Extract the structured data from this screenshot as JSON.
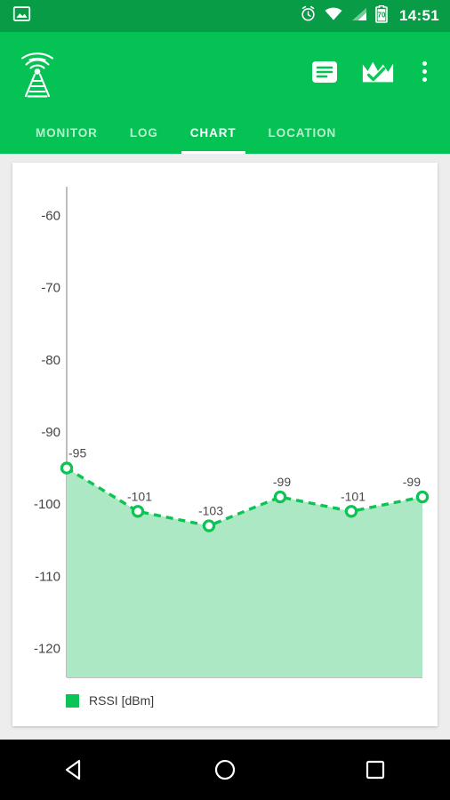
{
  "statusbar": {
    "time": "14:51",
    "battery_level": "70",
    "icons": [
      "image-icon",
      "alarm-icon",
      "wifi-icon",
      "signal-icon",
      "battery-icon"
    ]
  },
  "appbar": {
    "logo_icon": "cell-tower-icon",
    "actions": [
      {
        "name": "log-list-icon",
        "label": "Log"
      },
      {
        "name": "chart-check-icon",
        "label": "Chart"
      },
      {
        "name": "overflow-menu-icon",
        "label": "More options"
      }
    ]
  },
  "tabs": [
    {
      "label": "MONITOR",
      "active": false
    },
    {
      "label": "LOG",
      "active": false
    },
    {
      "label": "CHART",
      "active": true
    },
    {
      "label": "LOCATION",
      "active": false
    }
  ],
  "legend": {
    "label": "RSSI [dBm]",
    "color": "#0BC453"
  },
  "colors": {
    "statusbar": "#079C45",
    "appbar": "#05C254",
    "accent": "#0BC453",
    "area_fill": "#ACE8C4",
    "background": "#EDEDED",
    "card": "#FFFFFF"
  },
  "navbar": {
    "buttons": [
      {
        "name": "back-button",
        "label": "Back"
      },
      {
        "name": "home-button",
        "label": "Home"
      },
      {
        "name": "recents-button",
        "label": "Recents"
      }
    ]
  },
  "chart_data": {
    "type": "area",
    "title": "",
    "xlabel": "",
    "ylabel": "",
    "series": [
      {
        "name": "RSSI [dBm]",
        "values": [
          -95,
          -101,
          -103,
          -99,
          -101,
          -99
        ]
      }
    ],
    "point_labels": [
      "-95",
      "-101",
      "-103",
      "-99",
      "-101",
      "-99"
    ],
    "x": [
      0,
      1,
      2,
      3,
      4,
      5
    ],
    "ylim": [
      -124,
      -56
    ],
    "yticks": [
      -60,
      -70,
      -80,
      -90,
      -100,
      -110,
      -120
    ],
    "ytick_labels": [
      "-60",
      "-70",
      "-80",
      "-90",
      "-100",
      "-110",
      "-120"
    ],
    "grid": false,
    "legend_position": "bottom-left",
    "line_style": "dashed",
    "marker": "open-circle"
  }
}
